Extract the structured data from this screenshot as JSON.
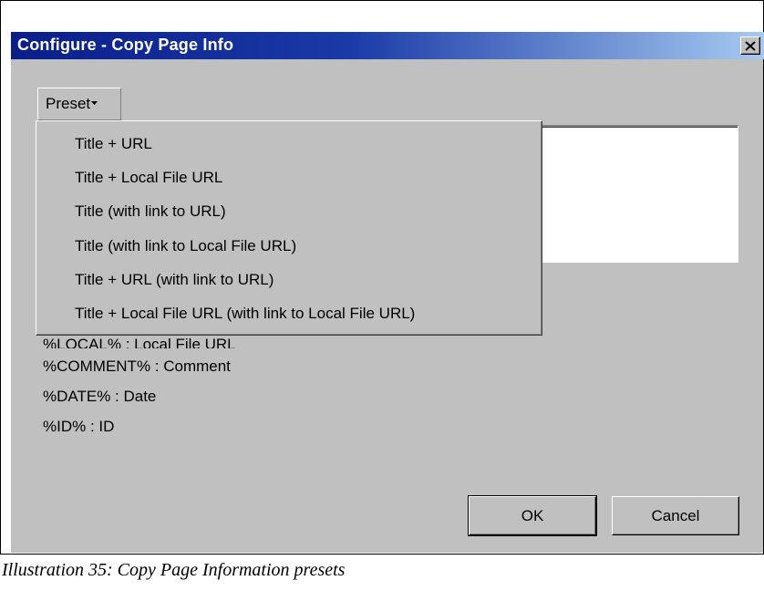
{
  "window": {
    "title": "Configure - Copy Page Info",
    "close_label": "×"
  },
  "preset": {
    "label": "Preset",
    "menu_items": [
      "Title + URL",
      "Title + Local File URL",
      "Title (with link to URL)",
      "Title (with link to Local File URL)",
      "Title + URL (with link to URL)",
      "Title + Local File URL (with link to Local File URL)"
    ]
  },
  "format_text": "",
  "variables": [
    "%LOCAL% : Local File URL",
    "%COMMENT% : Comment",
    "%DATE% : Date",
    "%ID% : ID"
  ],
  "buttons": {
    "ok": "OK",
    "cancel": "Cancel"
  },
  "caption": "Illustration 35: Copy Page Information presets",
  "colors": {
    "titlebar_start": "#0a1e8a",
    "titlebar_end": "#a6caf0",
    "face": "#c0c0c0"
  }
}
